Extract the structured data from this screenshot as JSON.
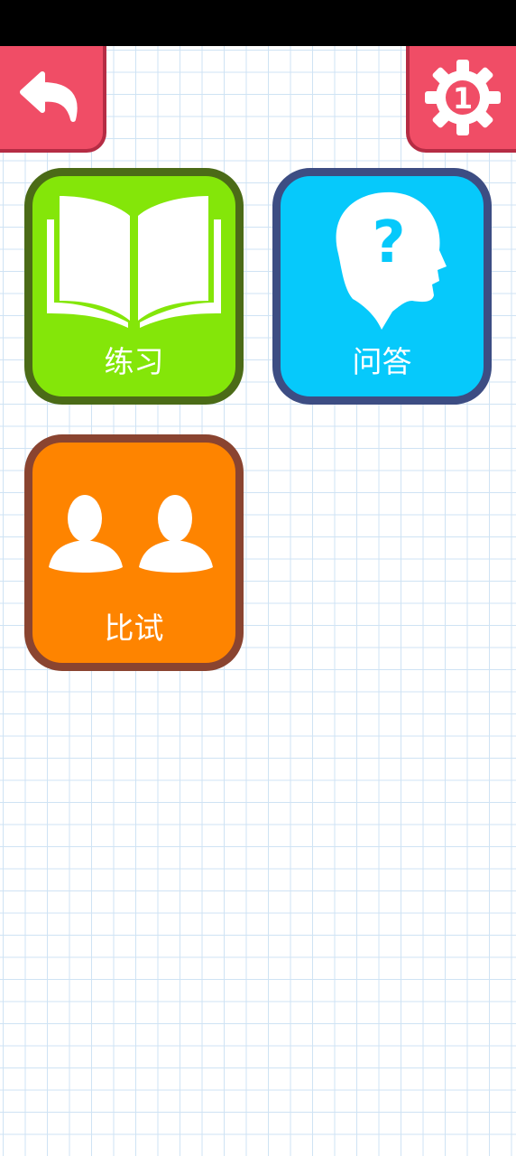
{
  "toolbar": {
    "back_icon": "undo-arrow-icon",
    "settings_icon": "gear-icon",
    "settings_badge": "1"
  },
  "menu": {
    "tiles": [
      {
        "label": "练习",
        "icon": "open-book-icon",
        "color": "#84e609",
        "border": "#4b6b17"
      },
      {
        "label": "问答",
        "icon": "question-head-icon",
        "color": "#06c9fb",
        "border": "#3d4d83"
      },
      {
        "label": "比试",
        "icon": "two-users-icon",
        "color": "#fe8400",
        "border": "#8a4430"
      }
    ]
  },
  "colors": {
    "accent": "#f04d66",
    "grid_line": "#cfe3f4"
  }
}
